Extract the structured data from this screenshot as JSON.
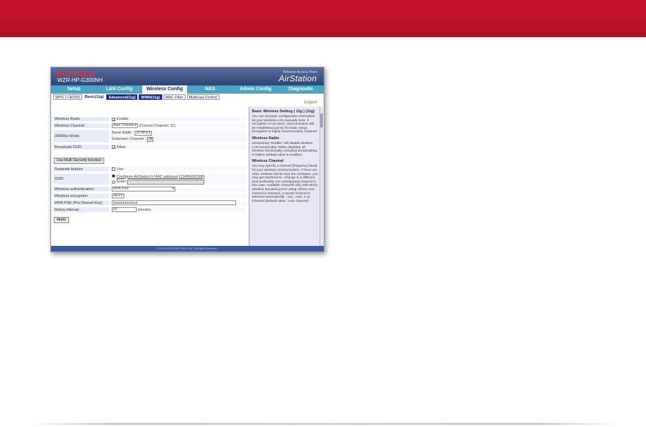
{
  "colors": {
    "banner": "#c8102e",
    "header": "#2e4577",
    "tabbar": "#4da3c4"
  },
  "router": {
    "brand": "BUFFALO",
    "model": "WZR-HP-G300NH",
    "product_tag": "Wireless Access Point",
    "product_name": "AirStation",
    "tabs": [
      "Setup",
      "LAN Config",
      "Wireless Config",
      "NAS",
      "Admin Config",
      "Diagnostic"
    ],
    "subtabs": [
      "WPS",
      "AOSS",
      "Basic(11g)",
      "Advanced(11g)",
      "WMM(11g)",
      "MAC Filter",
      "Multicast Control"
    ],
    "logout": "Logout",
    "form1": {
      "wireless_radio_label": "Wireless Radio",
      "wireless_radio_value": "Enable",
      "channel_label": "Wireless Channel",
      "channel_value": "Auto Channel",
      "channel_current": "(Current Channel: 11)",
      "mode_label": "300MHz Mode",
      "band_width_label": "Band Width :",
      "band_width_value": "20 MHz",
      "ext_channel_label": "Extension Channel :",
      "ext_channel_value": "-",
      "ssid_broadcast_label": "Broadcast SSID",
      "ssid_broadcast_value": "Allow"
    },
    "multi_security_btn": "Use Multi Security function",
    "form2": {
      "separate_label": "Separate feature",
      "separate_value": "Use",
      "ssid_label": "SSID",
      "ssid_opt1": "Configure AirStation's MAC address(123456000388)",
      "ssid_opt2": "Enter",
      "auth_label": "Wireless authentication",
      "auth_value": "WPA-PSK",
      "enc_label": "Wireless encryption",
      "enc_value": "AES",
      "psk_label": "WPA-PSK (Pre-Shared Key)",
      "psk_value": "●●●●●●●●●●●●●",
      "rekey_label": "Rekey interval",
      "rekey_value": "60",
      "rekey_unit": "minutes"
    },
    "apply_btn": "Apply",
    "help": {
      "title": "Basic Wireless Setting ( 11g ) (11g)",
      "intro": "You can set basic configuration information for your wireless LAN manually here. If encryption is not used, communication will be established just by the basic setup. Encryption is highly recommended, however.",
      "radio_title": "Wireless Radio",
      "radio_text": "Unchecking \"Enable\" will disable wireless LAN functionality. When disabled, all wireless functionality, including broadcasting, is halted. Default value is enabled.",
      "channel_title": "Wireless Channel",
      "channel_text": "You may specify a channel (frequency band) for your wireless communication. If there are other wireless clients near the AirStation, you may get interference. Change to a different (and preferably non-overlapping) channel in this case. Available channels vary with which wireless standard you're using. When Auto channel is selected, a vacant channel is selected automatically : 11g : Auto, 1-11 Channel (Default value : Auto channel)"
    },
    "footer": "(C)2000-2009 BUFFALO INC. All rights reserved."
  }
}
